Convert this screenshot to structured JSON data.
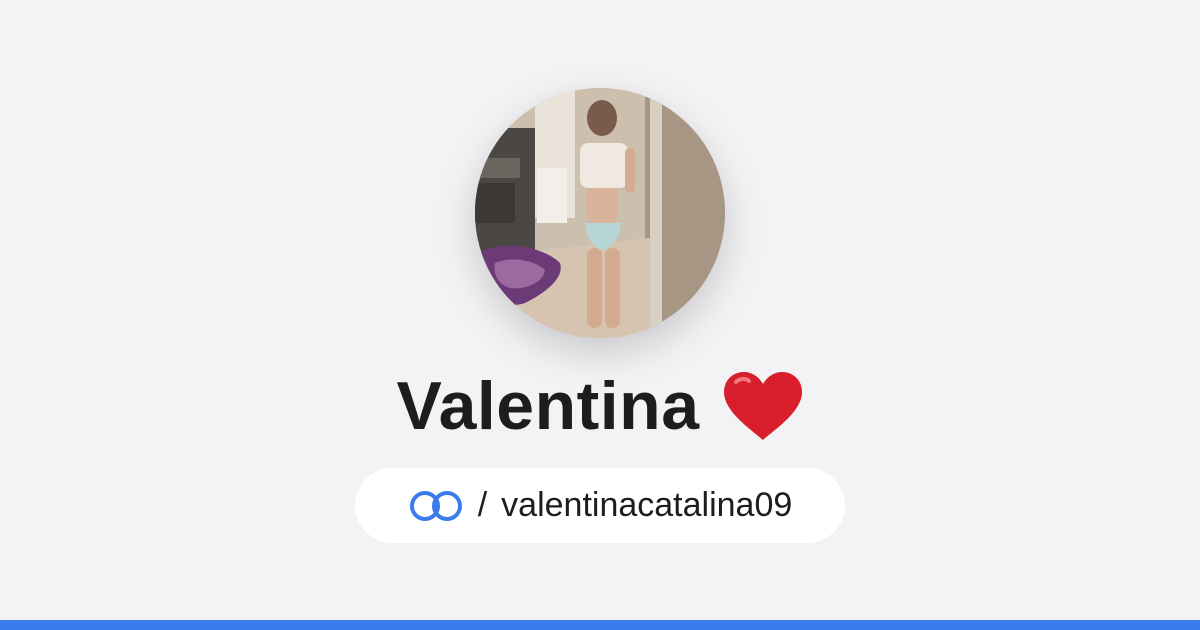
{
  "profile": {
    "display_name": "Valentina",
    "name_emoji": "heart-icon",
    "separator": "/",
    "username": "valentinacatalina09",
    "avatar": "profile-photo"
  },
  "colors": {
    "background": "#f3f3f6",
    "pill_background": "#ffffff",
    "accent_blue": "#3a7cec",
    "heart_red": "#d81e2c",
    "text": "#1d1d1f"
  }
}
